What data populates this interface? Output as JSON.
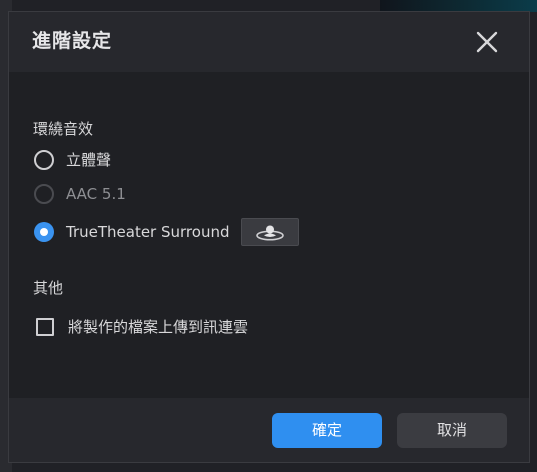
{
  "dialog": {
    "title": "進階設定",
    "close_icon": "close-icon"
  },
  "surround": {
    "section_label": "環繞音效",
    "options": [
      {
        "label": "立體聲",
        "checked": false,
        "disabled": false
      },
      {
        "label": "AAC 5.1",
        "checked": false,
        "disabled": true
      },
      {
        "label": "TrueTheater Surround",
        "checked": true,
        "disabled": false
      }
    ],
    "settings_icon": "surround-settings-icon"
  },
  "other": {
    "section_label": "其他",
    "upload_label": "將製作的檔案上傳到訊連雲",
    "upload_checked": false
  },
  "footer": {
    "ok_label": "確定",
    "cancel_label": "取消"
  },
  "colors": {
    "accent": "#2f8ff0",
    "dialog_bg": "#1f2024",
    "header_bg": "#27282d"
  }
}
